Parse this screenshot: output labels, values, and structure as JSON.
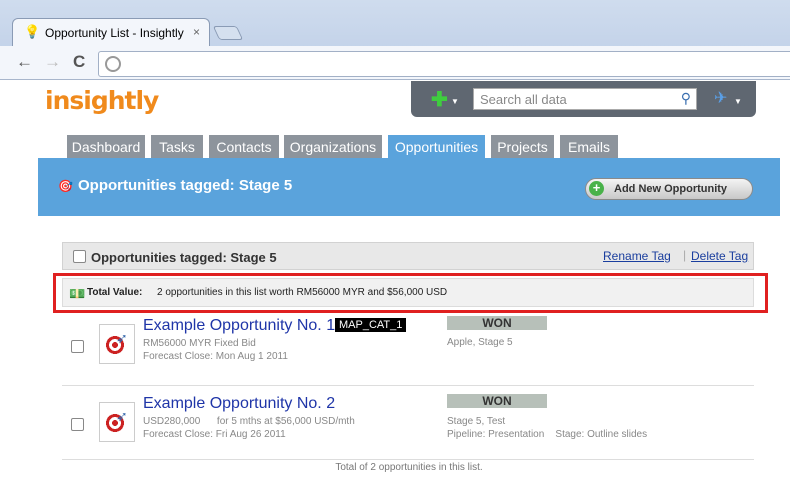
{
  "browser": {
    "tab_title": "Opportunity List - Insightly",
    "tab_close": "×",
    "back": "←",
    "forward": "→",
    "reload": "C"
  },
  "app": {
    "logo": "insightly",
    "search_placeholder": "Search all data",
    "nav_tabs": [
      {
        "label": "Dashboard"
      },
      {
        "label": "Tasks"
      },
      {
        "label": "Contacts"
      },
      {
        "label": "Organizations"
      },
      {
        "label": "Opportunities"
      },
      {
        "label": "Projects"
      },
      {
        "label": "Emails"
      }
    ],
    "active_tab": "Opportunities"
  },
  "panel": {
    "title": "Opportunities tagged: Stage 5",
    "add_button": "Add New Opportunity",
    "list_header": "Opportunities tagged: Stage 5",
    "rename_tag": "Rename Tag",
    "delete_tag": "Delete Tag",
    "separator": "|",
    "total_label": "Total Value:",
    "total_text": "2 opportunities in this list worth RM56000 MYR and $56,000 USD",
    "footer": "Total of 2 opportunities in this list."
  },
  "opportunities": [
    {
      "name": "Example Opportunity No. 1",
      "badge": "MAP_CAT_1",
      "value": "RM56000 MYR Fixed Bid",
      "forecast": "Forecast Close: Mon Aug 1 2011",
      "status": "WON",
      "tags": "Apple, Stage 5"
    },
    {
      "name": "Example Opportunity No. 2",
      "value": "USD280,000      for 5 mths at $56,000 USD/mth",
      "forecast": "Forecast Close: Fri Aug 26 2011",
      "status": "WON",
      "tags": "Stage 5, Test",
      "pipeline": "Pipeline: Presentation    Stage: Outline slides"
    }
  ],
  "colors": {
    "accent": "#5aa3dc",
    "logo": "#f08a1c",
    "highlight_box": "#e02020",
    "won_badge": "#b7c0b9"
  }
}
